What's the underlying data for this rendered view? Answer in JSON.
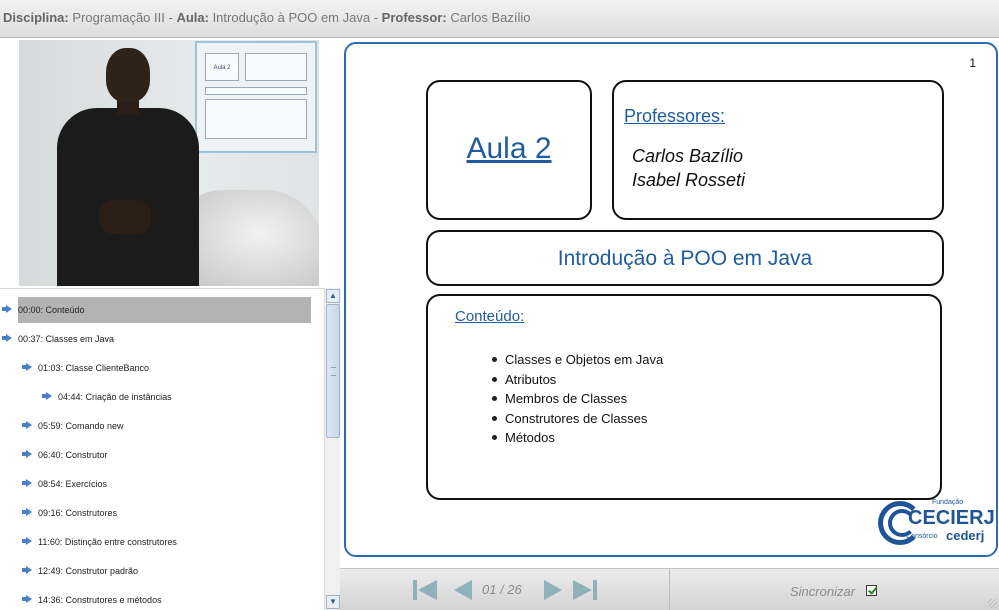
{
  "header": {
    "disciplina_label": "Disciplina:",
    "disciplina_value": "Programação III",
    "sep1": " - ",
    "aula_label": "Aula:",
    "aula_value": "Introdução à POO em Java",
    "sep2": " - ",
    "professor_label": "Professor:",
    "professor_value": "Carlos Bazílio"
  },
  "video": {
    "screen_text": "Aula 2"
  },
  "playlist": {
    "items": [
      {
        "label": "00:00: Conteúdo",
        "active": true
      },
      {
        "label": "00:37: Classes em Java"
      },
      {
        "label": "01:03: Classe ClienteBanco"
      },
      {
        "label": "04:44: Criação de instâncias"
      },
      {
        "label": "05:59: Comando new"
      },
      {
        "label": "06:40: Construtor"
      },
      {
        "label": "08:54: Exercícios"
      },
      {
        "label": "09:16: Construtores"
      },
      {
        "label": "11:60: Distinção entre construtores"
      },
      {
        "label": "12:49: Construtor padrão"
      },
      {
        "label": "14:36: Construtores e métodos"
      }
    ]
  },
  "slide": {
    "page_number": "1",
    "aula_title": "Aula 2",
    "professores_label": "Professores",
    "professores_colon": ":",
    "professores": [
      "Carlos Bazílio",
      "Isabel Rosseti"
    ],
    "intro_title": "Introdução à POO em Java",
    "conteudo_label": "Conteúdo",
    "conteudo_colon": ":",
    "conteudo_items": [
      "Classes e Objetos em Java",
      "Atributos",
      "Membros de Classes",
      "Construtores de Classes",
      "Métodos"
    ],
    "logo": {
      "fundacao": "Fundação",
      "name": "CECIERJ",
      "consorcio": "Consórcio",
      "cederj": "cederj"
    }
  },
  "controls": {
    "counter": "01 / 26",
    "sync_label": "Sincronizar",
    "sync_checked": true
  },
  "colors": {
    "accent_blue": "#1f5b9e",
    "nav_icon": "#8fb1b8",
    "playlist_arrow": "#4a7fc9",
    "active_row": "#b3b3b3"
  }
}
